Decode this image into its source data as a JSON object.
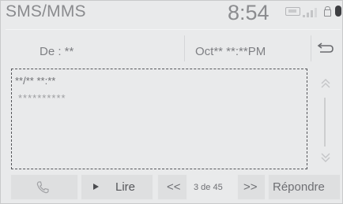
{
  "header": {
    "title": "SMS/MMS",
    "time": "8:54",
    "status_icons": [
      "dcm-icon",
      "signal-bars-icon",
      "lock-icon",
      "bluetooth-icon"
    ]
  },
  "sender_row": {
    "from": "De : **",
    "date": "Oct** **:**PM",
    "back_icon": "back-arrow-icon"
  },
  "message": {
    "header": "**/** **:**",
    "body": "**********"
  },
  "scroll": {
    "up_icon": "chevron-up-icon",
    "down_icon": "chevron-down-icon"
  },
  "bottom_bar": {
    "call_icon": "phone-icon",
    "read_label": "Lire",
    "prev_label": "<<",
    "pager": "3 de 45",
    "next_label": ">>",
    "reply_label": "Répondre"
  },
  "colors": {
    "background": "#e9eaeb",
    "button": "#dedfe0",
    "text": "#7e7f83",
    "dashed_frame": "#55565a"
  }
}
